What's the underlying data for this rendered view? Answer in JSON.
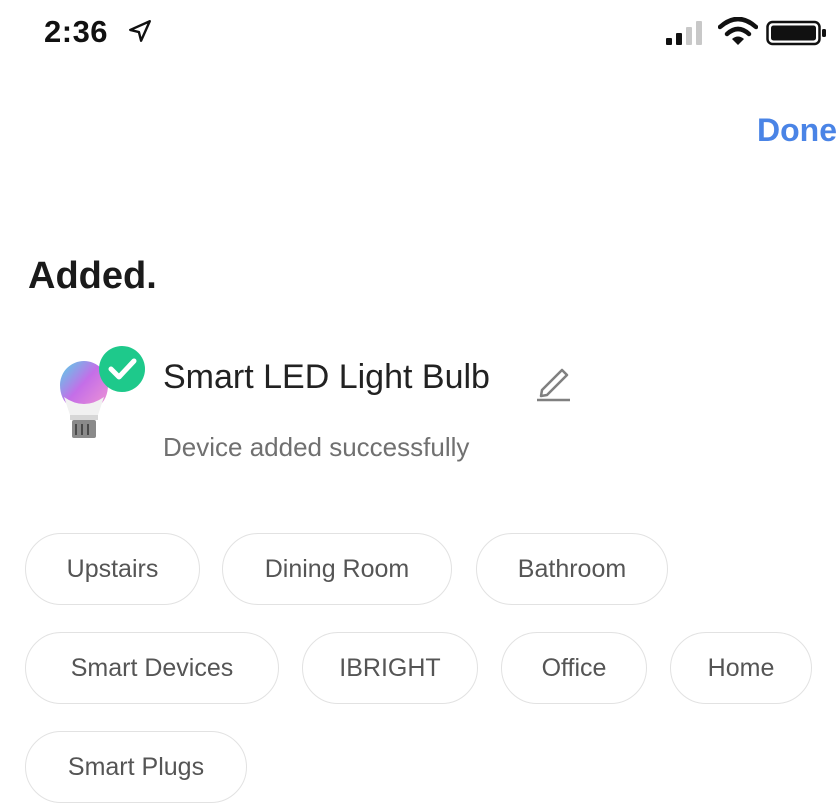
{
  "status_bar": {
    "time": "2:36",
    "icons": [
      "location-arrow-icon",
      "cellular-signal-icon",
      "wifi-icon",
      "battery-icon"
    ]
  },
  "header": {
    "done_label": "Done"
  },
  "page": {
    "title": "Added."
  },
  "device": {
    "name": "Smart LED Light Bulb",
    "status": "Device added successfully",
    "icon": "light-bulb-icon",
    "badge_icon": "check-circle-icon"
  },
  "rooms": [
    "Upstairs",
    "Dining Room",
    "Bathroom",
    "Smart Devices",
    "IBRIGHT",
    "Office",
    "Home",
    "Smart Plugs"
  ],
  "colors": {
    "accent": "#4a84e6",
    "success": "#1ec98b",
    "tag_border": "#e2e2e2"
  }
}
